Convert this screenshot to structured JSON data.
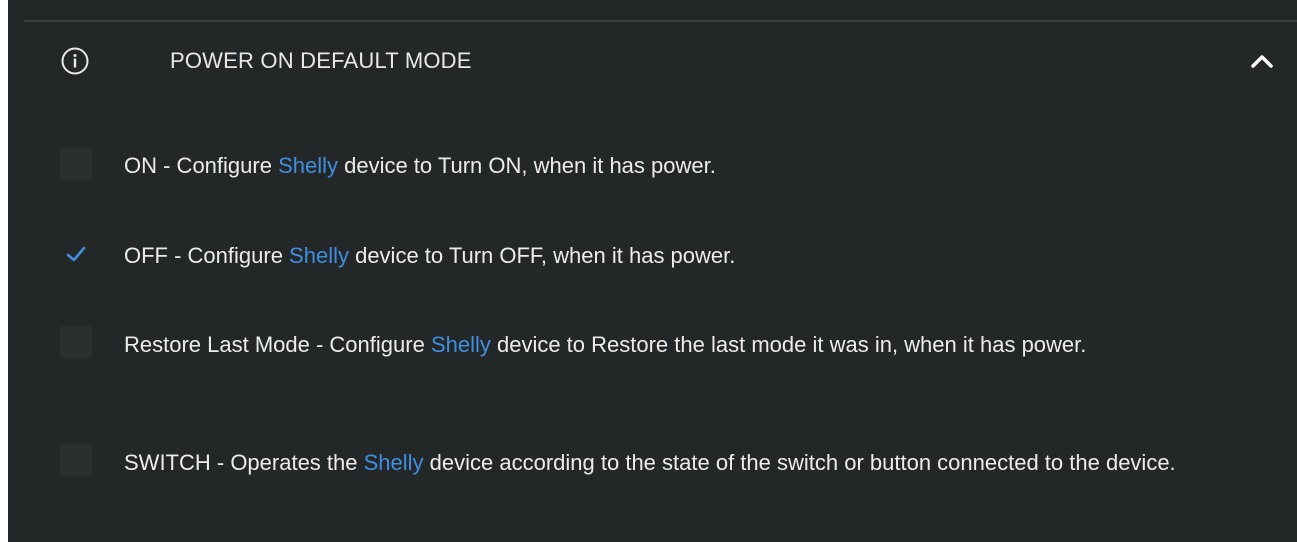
{
  "section": {
    "title": "POWER ON DEFAULT MODE",
    "expanded": true,
    "info_icon": "info-circle-icon",
    "collapse_icon": "chevron-up-icon"
  },
  "options": [
    {
      "checked": false,
      "prefix": "ON - Configure ",
      "brand": "Shelly",
      "suffix": " device to Turn ON, when it has power."
    },
    {
      "checked": true,
      "prefix": "OFF - Configure ",
      "brand": "Shelly",
      "suffix": " device to Turn OFF, when it has power."
    },
    {
      "checked": false,
      "prefix": "Restore Last Mode - Configure ",
      "brand": "Shelly",
      "suffix": " device to Restore the last mode it was in, when it has power."
    },
    {
      "checked": false,
      "prefix": "SWITCH - Operates the ",
      "brand": "Shelly",
      "suffix": " device according to the state of the switch or button connected to the device."
    }
  ],
  "colors": {
    "background": "#242728",
    "text": "#ececec",
    "brand": "#3f8fe0",
    "check": "#3f8fe0"
  }
}
